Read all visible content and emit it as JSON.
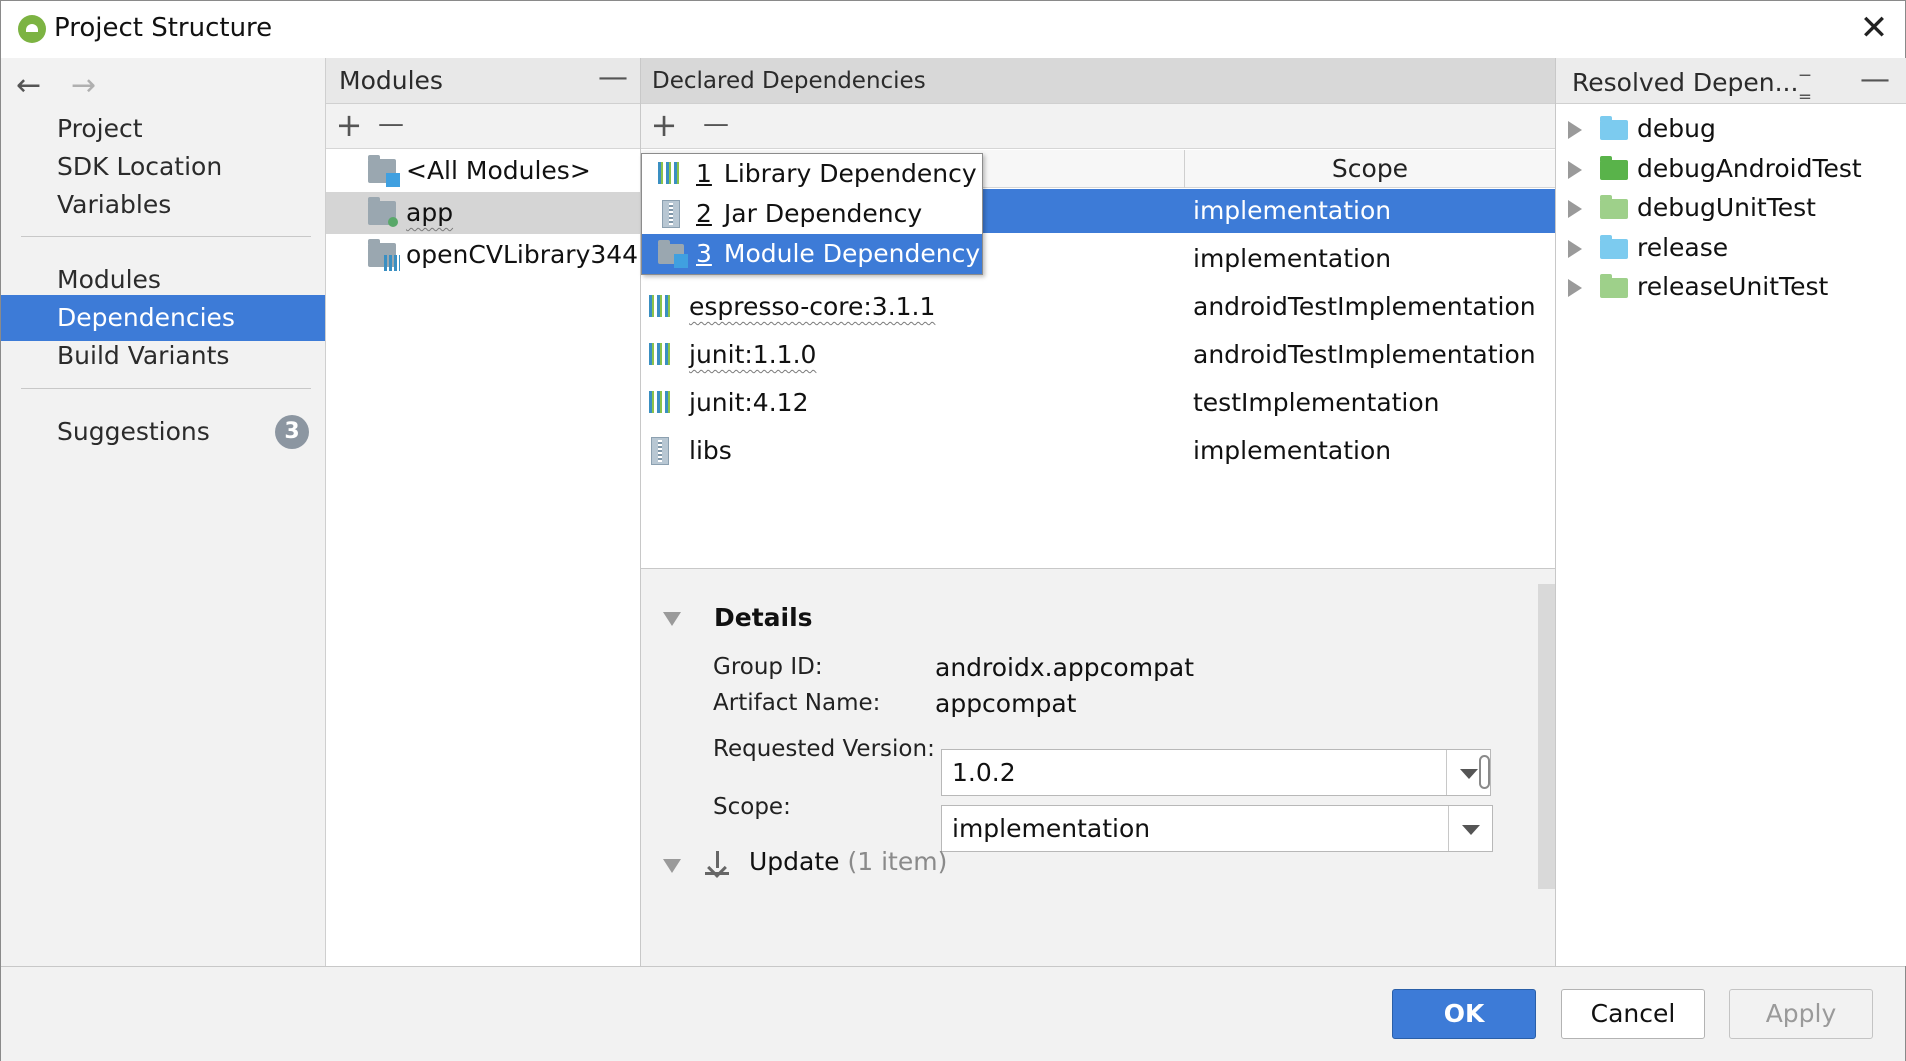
{
  "window": {
    "title": "Project Structure",
    "close_glyph": "✕"
  },
  "nav": {
    "back_glyph": "←",
    "forward_glyph": "→",
    "items_top": [
      "Project",
      "SDK Location",
      "Variables"
    ],
    "items_mid": [
      "Modules",
      "Dependencies",
      "Build Variants"
    ],
    "selected": "Dependencies",
    "suggestions_label": "Suggestions",
    "suggestions_count": "3"
  },
  "modules": {
    "header": "Modules",
    "minus_glyph": "—",
    "add_glyph": "+",
    "remove_glyph": "—",
    "items": [
      "<All Modules>",
      "app",
      "openCVLibrary344"
    ],
    "selected": "app"
  },
  "declared": {
    "header": "Declared Dependencies",
    "add_glyph": "+",
    "remove_glyph": "—",
    "scope_column": "Scope",
    "rows": [
      {
        "name": "",
        "scope": "implementation"
      },
      {
        "name": "",
        "scope": "implementation"
      },
      {
        "name": "espresso-core:3.1.1",
        "scope": "androidTestImplementation"
      },
      {
        "name": "junit:1.1.0",
        "scope": "androidTestImplementation"
      },
      {
        "name": "junit:4.12",
        "scope": "testImplementation"
      },
      {
        "name": "libs",
        "scope": "implementation"
      }
    ],
    "popup": [
      {
        "mnemonic": "1",
        "label": "Library Dependency"
      },
      {
        "mnemonic": "2",
        "label": "Jar Dependency"
      },
      {
        "mnemonic": "3",
        "label": "Module Dependency"
      }
    ]
  },
  "details": {
    "title": "Details",
    "group_id_label": "Group ID:",
    "group_id_value": "androidx.appcompat",
    "artifact_label": "Artifact Name:",
    "artifact_value": "appcompat",
    "version_label": "Requested Version:",
    "version_value": "1.0.2",
    "scope_label": "Scope:",
    "scope_value": "implementation",
    "update_label": "Update",
    "update_count": "(1 item)"
  },
  "resolved": {
    "header": "Resolved Depen...",
    "minus_glyph": "—",
    "items": [
      {
        "label": "debug",
        "color": "#7ccbef"
      },
      {
        "label": "debugAndroidTest",
        "color": "#59b34a"
      },
      {
        "label": "debugUnitTest",
        "color": "#9ed08a"
      },
      {
        "label": "release",
        "color": "#7ccbef"
      },
      {
        "label": "releaseUnitTest",
        "color": "#9ed08a"
      }
    ]
  },
  "footer": {
    "ok": "OK",
    "cancel": "Cancel",
    "apply": "Apply"
  },
  "colors": {
    "accent": "#3d7bd7",
    "badge": "#8c96a1"
  }
}
